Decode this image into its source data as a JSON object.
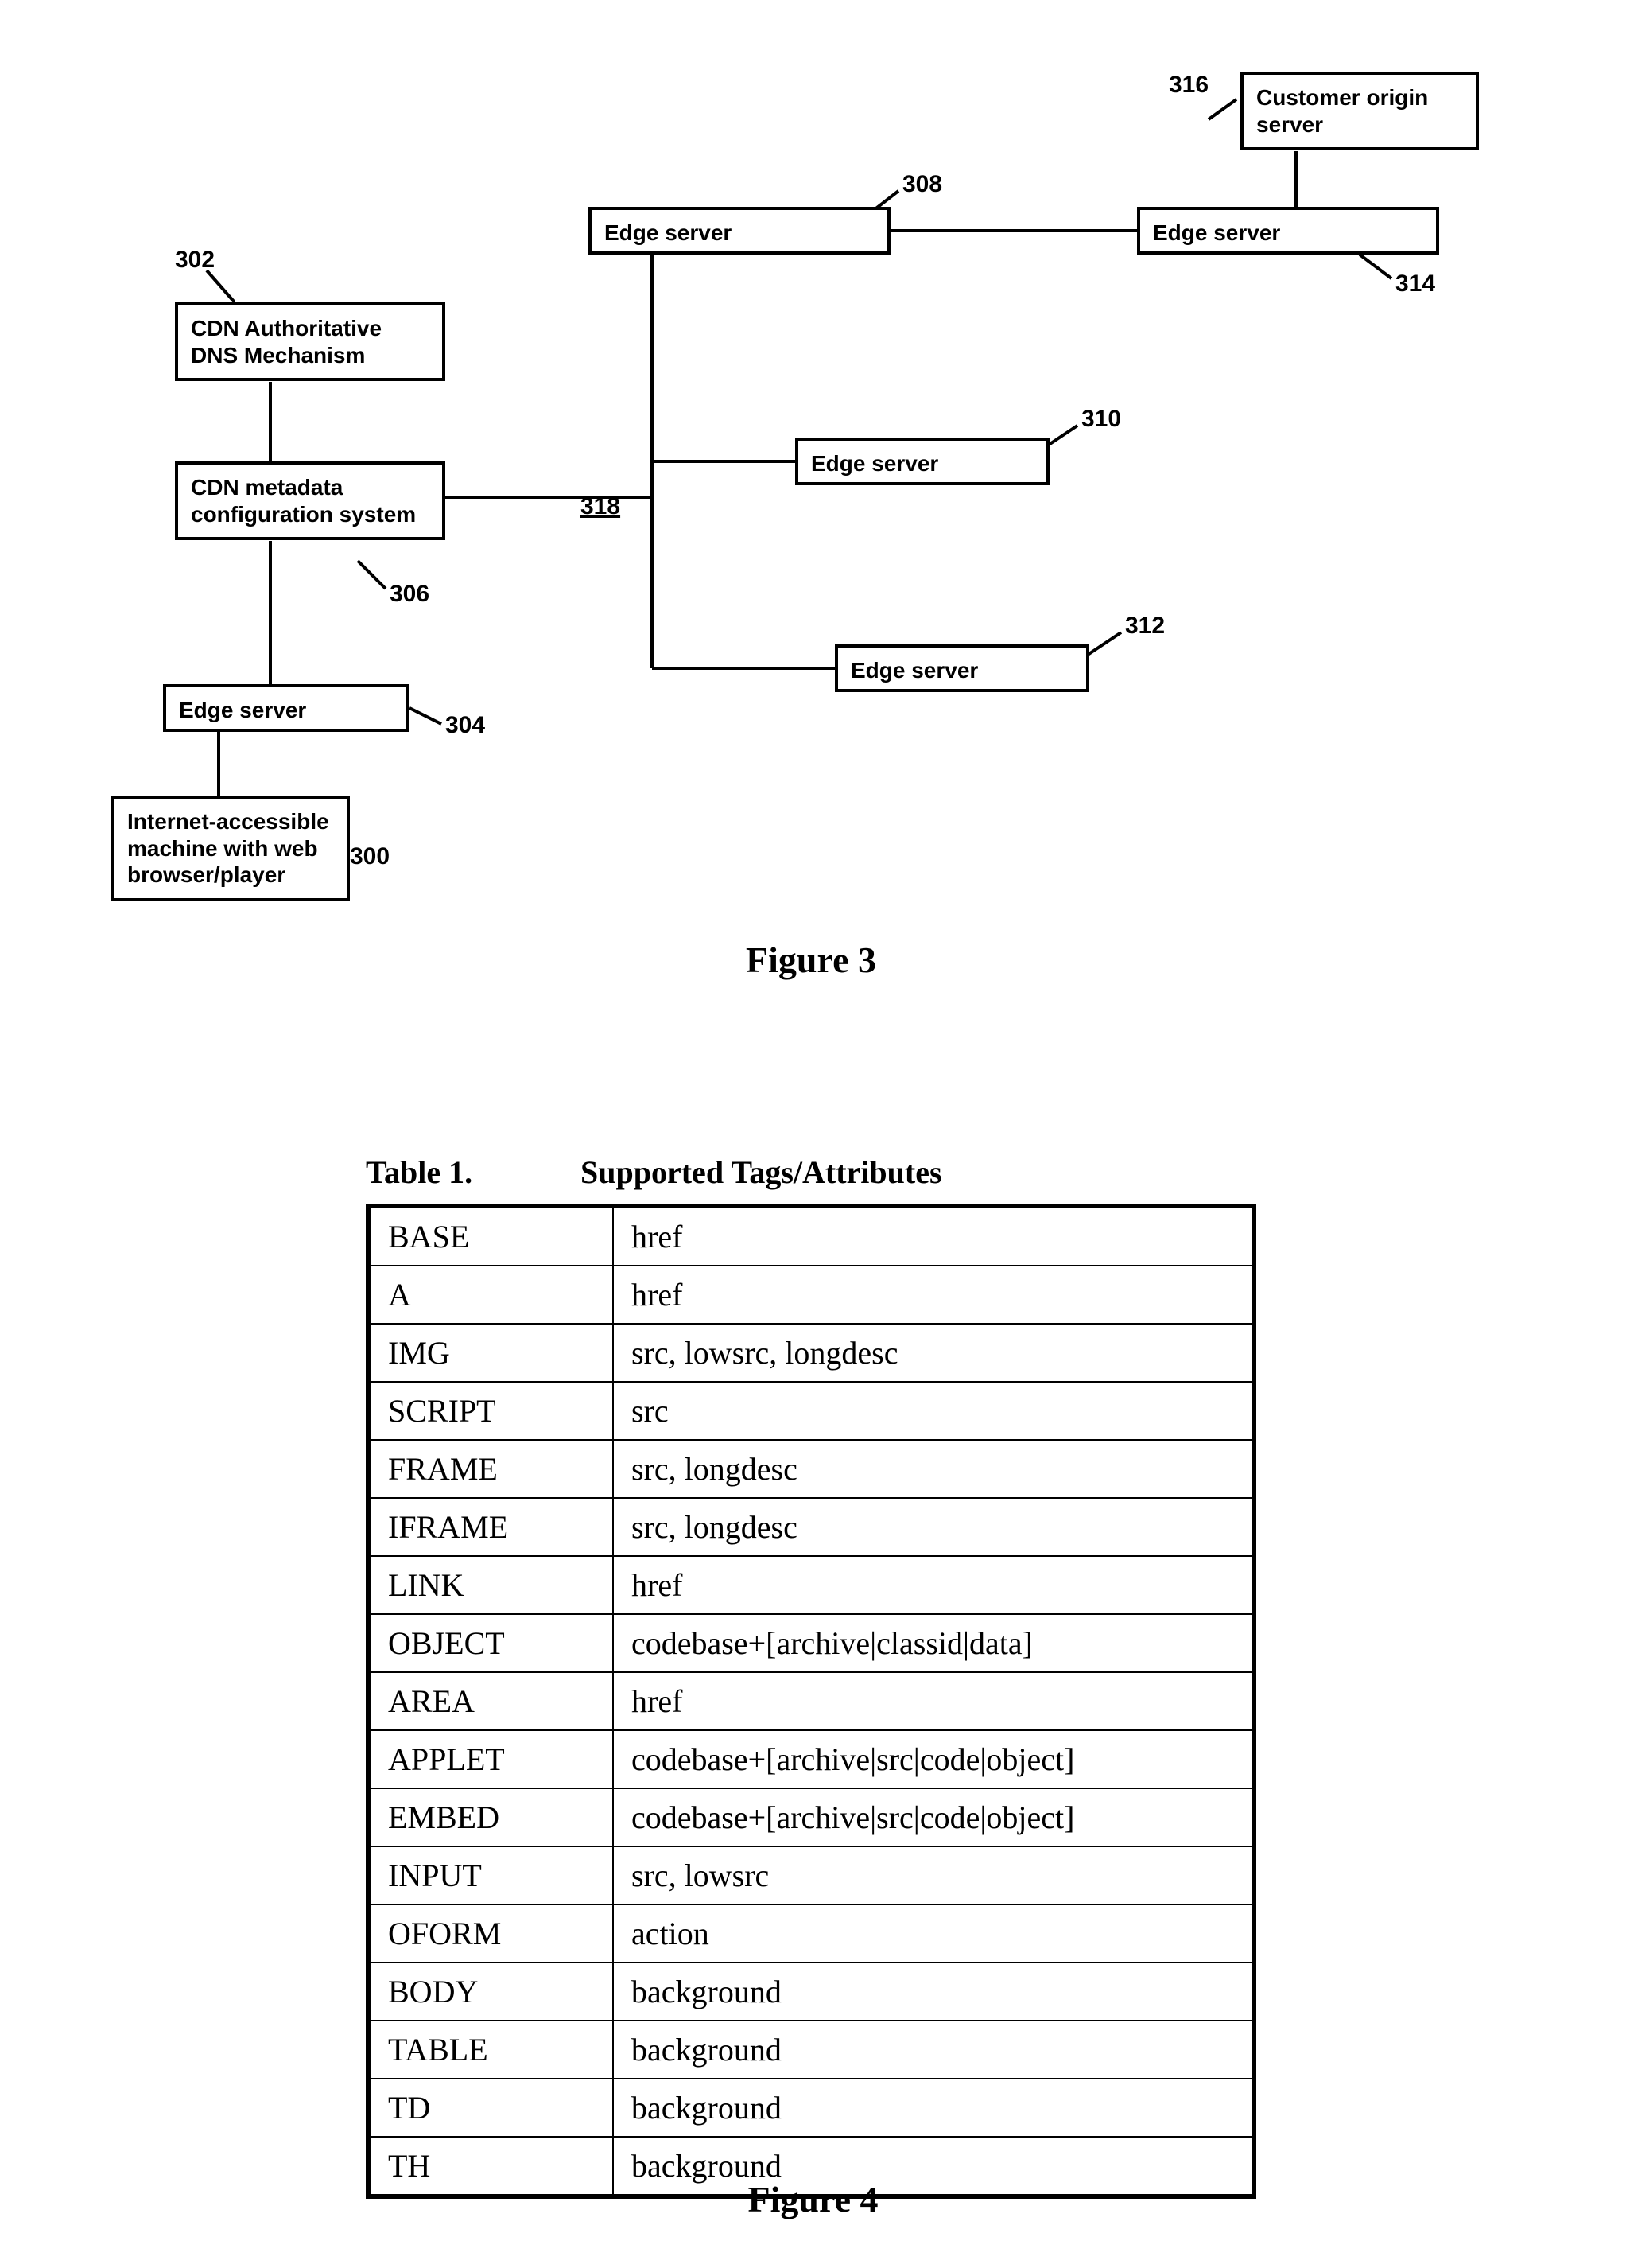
{
  "figure3": {
    "title": "Figure 3",
    "boxes": {
      "client": {
        "text": "Internet-accessible machine with web browser/player",
        "ref": "300"
      },
      "edge304": {
        "text": "Edge server",
        "ref": "304"
      },
      "dns": {
        "text": "CDN Authoritative DNS Mechanism",
        "ref": "302"
      },
      "metadata": {
        "text": "CDN metadata configuration system",
        "ref": "306"
      },
      "edge308": {
        "text": "Edge server",
        "ref": "308"
      },
      "edge310": {
        "text": "Edge server",
        "ref": "310"
      },
      "edge312": {
        "text": "Edge server",
        "ref": "312"
      },
      "edge314": {
        "text": "Edge server",
        "ref": "314"
      },
      "origin": {
        "text": "Customer origin server",
        "ref": "316"
      },
      "link318": {
        "ref": "318"
      }
    }
  },
  "figure4": {
    "caption_label": "Table 1.",
    "caption_title": "Supported Tags/Attributes",
    "title": "Figure 4",
    "rows": [
      {
        "tag": "BASE",
        "attrs": "href"
      },
      {
        "tag": "A",
        "attrs": "href"
      },
      {
        "tag": "IMG",
        "attrs": "src, lowsrc, longdesc"
      },
      {
        "tag": "SCRIPT",
        "attrs": "src"
      },
      {
        "tag": "FRAME",
        "attrs": "src, longdesc"
      },
      {
        "tag": "IFRAME",
        "attrs": "src, longdesc"
      },
      {
        "tag": "LINK",
        "attrs": "href"
      },
      {
        "tag": "OBJECT",
        "attrs": "codebase+[archive|classid|data]"
      },
      {
        "tag": "AREA",
        "attrs": "href"
      },
      {
        "tag": "APPLET",
        "attrs": "codebase+[archive|src|code|object]"
      },
      {
        "tag": "EMBED",
        "attrs": "codebase+[archive|src|code|object]"
      },
      {
        "tag": "INPUT",
        "attrs": "src, lowsrc"
      },
      {
        "tag": "OFORM",
        "attrs": "action"
      },
      {
        "tag": "BODY",
        "attrs": "background"
      },
      {
        "tag": "TABLE",
        "attrs": "background"
      },
      {
        "tag": "TD",
        "attrs": "background"
      },
      {
        "tag": "TH",
        "attrs": "background"
      }
    ]
  }
}
